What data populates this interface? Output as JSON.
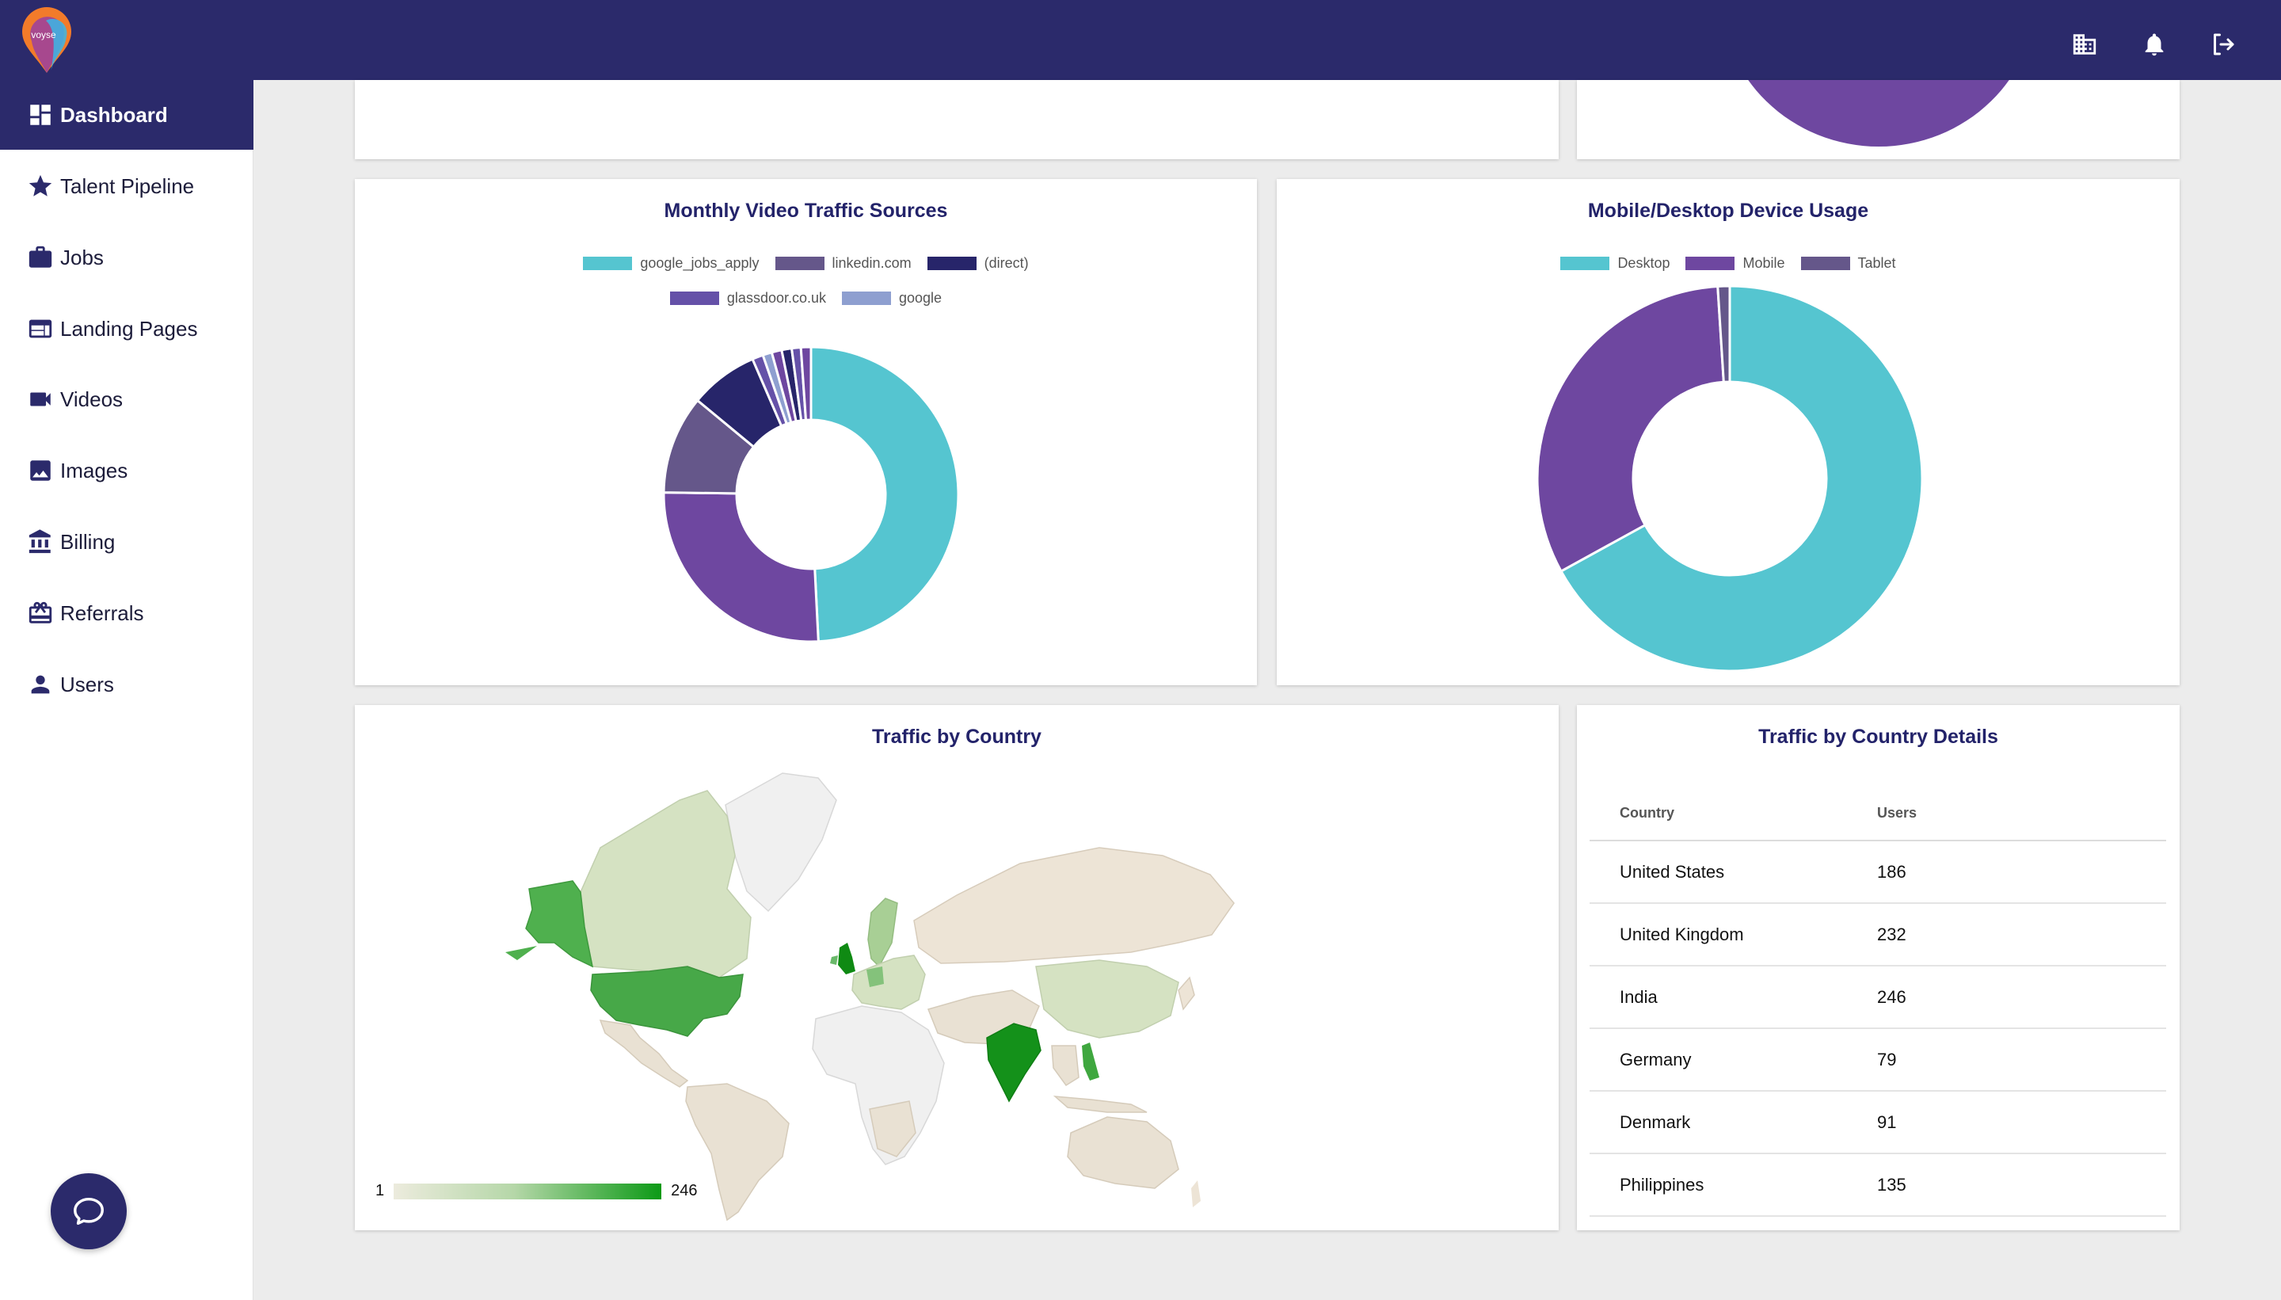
{
  "brand": {
    "logo_text": "voyse"
  },
  "header": {
    "icons": [
      "building-icon",
      "bell-icon",
      "logout-icon"
    ]
  },
  "sidebar": {
    "items": [
      {
        "label": "Dashboard",
        "icon": "dashboard-icon",
        "active": true
      },
      {
        "label": "Talent Pipeline",
        "icon": "star-icon"
      },
      {
        "label": "Jobs",
        "icon": "briefcase-icon"
      },
      {
        "label": "Landing Pages",
        "icon": "web-page-icon"
      },
      {
        "label": "Videos",
        "icon": "video-camera-icon"
      },
      {
        "label": "Images",
        "icon": "image-icon"
      },
      {
        "label": "Billing",
        "icon": "bank-icon"
      },
      {
        "label": "Referrals",
        "icon": "gift-card-icon"
      },
      {
        "label": "Users",
        "icon": "person-icon"
      }
    ]
  },
  "colors": {
    "navy": "#2b2a6b",
    "teal": "#55c5d0",
    "purple": "#6e47a0",
    "slate": "#65578a",
    "dark_navy": "#27256a",
    "violet": "#6551a8",
    "light_blue": "#8e9fd0",
    "map_high": "#0c9a16",
    "map_low": "#ecebdd"
  },
  "chart_data": [
    {
      "type": "pie",
      "title": "Monthly Video Traffic Sources",
      "donut": true,
      "legend_position": "top",
      "categories": [
        "google_jobs_apply",
        "linkedin.com",
        "(direct)",
        "glassdoor.co.uk",
        "google"
      ],
      "colors": [
        "#55c5d0",
        "#65578a",
        "#27256a",
        "#6551a8",
        "#8e9fd0"
      ],
      "slices": [
        {
          "category": "google_jobs_apply",
          "value": 49.2
        },
        {
          "category": "(Mobile-slice purple)",
          "value": 26.0,
          "color": "#6e47a0"
        },
        {
          "category": "linkedin.com",
          "value": 10.8
        },
        {
          "category": "(direct)",
          "value": 7.5
        },
        {
          "category": "glassdoor.co.uk",
          "value": 1.2
        },
        {
          "category": "google",
          "value": 1.0
        },
        {
          "category": "other-a",
          "value": 1.1,
          "color": "#6e47a0"
        },
        {
          "category": "other-b",
          "value": 1.1,
          "color": "#27256a"
        },
        {
          "category": "other-c",
          "value": 1.0,
          "color": "#6551a8"
        },
        {
          "category": "other-d",
          "value": 1.1,
          "color": "#6e47a0"
        }
      ]
    },
    {
      "type": "pie",
      "title": "Mobile/Desktop Device Usage",
      "donut": true,
      "legend_position": "top",
      "categories": [
        "Desktop",
        "Mobile",
        "Tablet"
      ],
      "colors": [
        "#55c5d0",
        "#6e47a0",
        "#65578a"
      ],
      "values": [
        67.0,
        32.0,
        1.0
      ]
    },
    {
      "type": "table",
      "title": "Traffic by Country Details",
      "columns": [
        "Country",
        "Users"
      ],
      "rows": [
        [
          "United States",
          "186"
        ],
        [
          "United Kingdom",
          "232"
        ],
        [
          "India",
          "246"
        ],
        [
          "Germany",
          "79"
        ],
        [
          "Denmark",
          "91"
        ],
        [
          "Philippines",
          "135"
        ]
      ]
    }
  ],
  "map": {
    "title": "Traffic by Country",
    "legend_min": "1",
    "legend_max": "246"
  }
}
